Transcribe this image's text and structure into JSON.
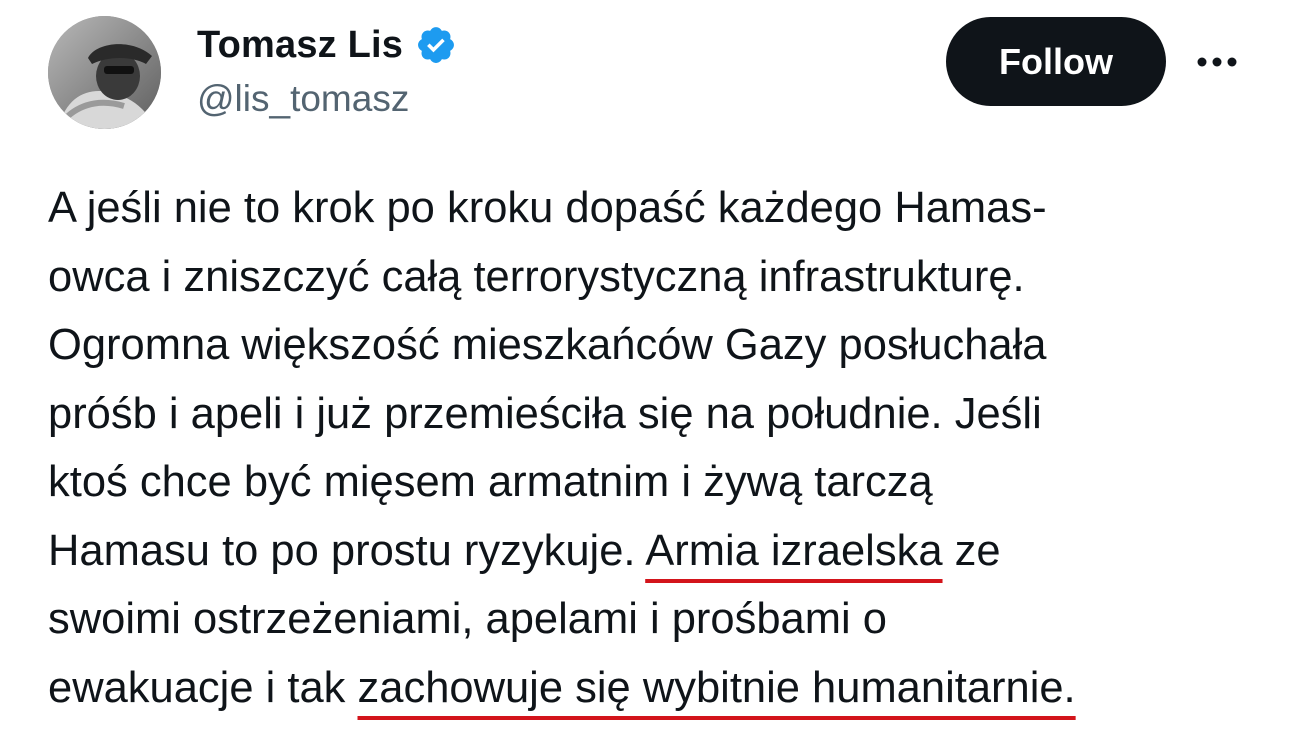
{
  "author": {
    "display_name": "Tomasz Lis",
    "handle": "@lis_tomasz",
    "verified_icon": "verified-badge-icon",
    "avatar": "avatar-photo"
  },
  "actions": {
    "follow_label": "Follow",
    "more_icon": "more-options-icon"
  },
  "tweet": {
    "lines": [
      "A jeśli nie to krok po kroku dopaść każdego Hamas-",
      "owca i zniszczyć całą terrorystyczną infrastrukturę.",
      "Ogromna większość mieszkańców Gazy posłuchała",
      "próśb i apeli i już przemieściła się na południe. Jeśli",
      "ktoś chce być mięsem armatnim i żywą tarczą",
      "Hamasu to po prostu ryzykuje. ",
      "Armia izraelska",
      " ze",
      "swoimi ostrzeżeniami, apelami i prośbami o",
      "ewakuacje i tak ",
      "zachowuje się wybitnie humanitarnie."
    ]
  },
  "colors": {
    "text": "#0f1419",
    "secondary_text": "#536471",
    "verified_blue": "#1d9bf0",
    "follow_bg": "#0f1419",
    "follow_text": "#ffffff",
    "underline_red": "#d3141b"
  }
}
